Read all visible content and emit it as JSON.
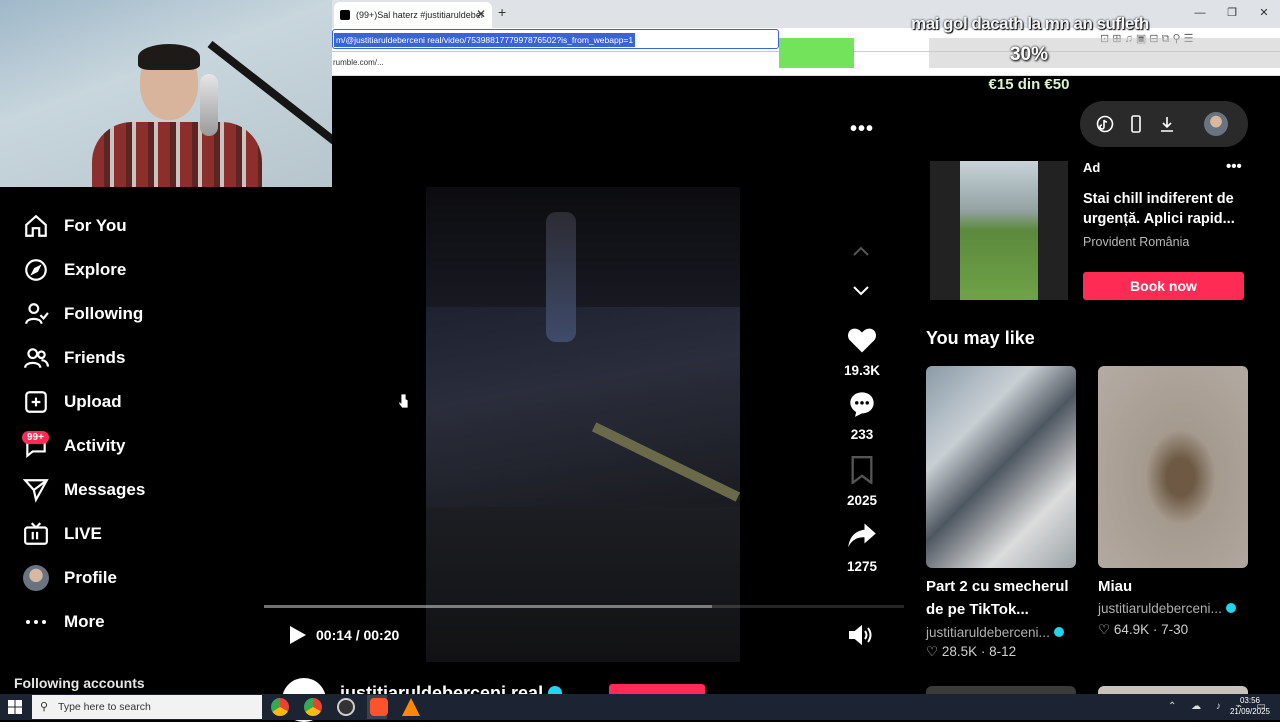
{
  "browser": {
    "tab_title": "(99+)Sal haterz #justitiaruldeber",
    "new_tab": "+",
    "win_min": "—",
    "win_max": "❐",
    "win_close": "✕",
    "url": "m/@justitiaruldeberceni real/video/7539881777997876502?is_from_webapp=1",
    "bookmark_suggest": "rumble.com/..."
  },
  "overlay": {
    "text": "mai gol dacath la mn an sufleth",
    "goal_percent": "30%",
    "goal_amount": "€15 din €50",
    "goal_fraction": 0.3
  },
  "sidebar": {
    "items": [
      {
        "label": "For You"
      },
      {
        "label": "Explore"
      },
      {
        "label": "Following"
      },
      {
        "label": "Friends"
      },
      {
        "label": "Upload"
      },
      {
        "label": "Activity"
      },
      {
        "label": "Messages"
      },
      {
        "label": "LIVE"
      },
      {
        "label": "Profile"
      },
      {
        "label": "More"
      }
    ],
    "activity_badge": "99+",
    "following_accounts": "Following accounts"
  },
  "video": {
    "time": "00:14 / 00:20",
    "progress": 0.7,
    "author": "justitiaruldeberceni real"
  },
  "actions": {
    "likes": "19.3K",
    "comments": "233",
    "saves": "2025",
    "shares": "1275"
  },
  "ad": {
    "label": "Ad",
    "title": "Stai chill indiferent de urgență. Aplici rapid...",
    "brand": "Provident România",
    "button": "Book now"
  },
  "recommendations": {
    "heading": "You may like",
    "cards": [
      {
        "title": "Part 2 cu smecherul de pe TikTok...",
        "author": "justitiaruldeberceni...",
        "likes": "28.5K",
        "date": "8-12"
      },
      {
        "title": "Miau",
        "author": "justitiaruldeberceni...",
        "likes": "64.9K",
        "date": "7-30"
      }
    ]
  },
  "taskbar": {
    "search_placeholder": "Type here to search",
    "time": "03:56",
    "date": "21/09/2025"
  }
}
